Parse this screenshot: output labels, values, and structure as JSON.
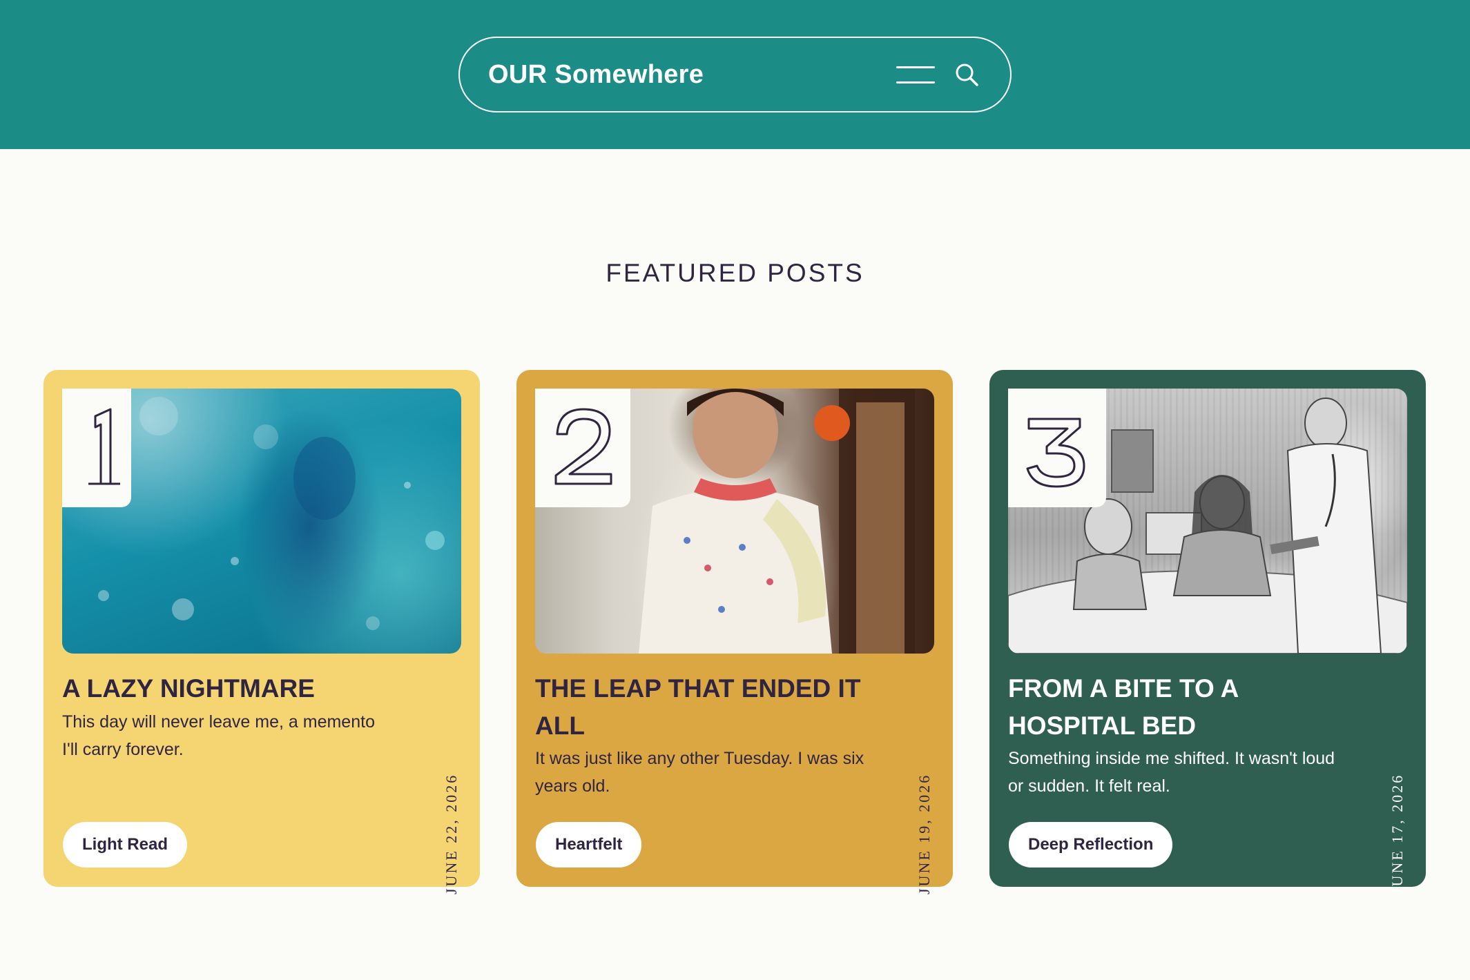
{
  "header": {
    "brand": "OUR Somewhere",
    "menu_icon": "hamburger-icon",
    "search_icon": "search-icon",
    "background": "#1b8c86"
  },
  "section": {
    "title": "FEATURED POSTS"
  },
  "posts": [
    {
      "number": "1",
      "title": "A LAZY NIGHTMARE",
      "excerpt": "This day will never leave me, a memento I'll carry forever.",
      "date": "JUNE 22, 2026",
      "tag": "Light Read",
      "card_color": "#f5d572"
    },
    {
      "number": "2",
      "title": "THE LEAP THAT ENDED IT ALL",
      "excerpt": "It was just like any other Tuesday. I was six years old.",
      "date": "JUNE 19, 2026",
      "tag": "Heartfelt",
      "card_color": "#dba743"
    },
    {
      "number": "3",
      "title": "FROM A BITE TO A HOSPITAL BED",
      "excerpt": "Something inside me shifted. It wasn't loud or sudden. It felt real.",
      "date": "JUNE 17, 2026",
      "tag": "Deep Reflection",
      "card_color": "#2f5f51"
    }
  ]
}
